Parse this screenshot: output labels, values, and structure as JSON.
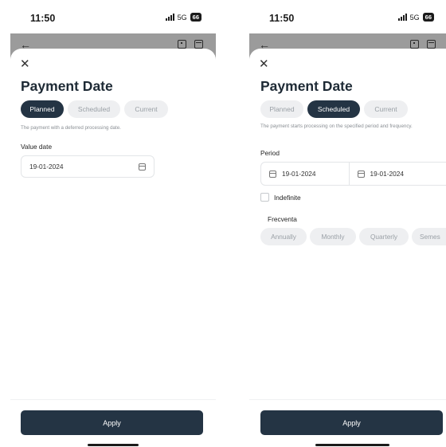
{
  "status": {
    "time": "11:50",
    "network": "5G",
    "battery": "66"
  },
  "screens": [
    {
      "title": "Payment Date",
      "tabs": [
        {
          "label": "Planned",
          "active": true
        },
        {
          "label": "Scheduled",
          "active": false
        },
        {
          "label": "Current",
          "active": false
        }
      ],
      "description": "The payment with a deferred processing date.",
      "value_date_label": "Value date",
      "value_date": "19-01-2024",
      "apply_label": "Apply"
    },
    {
      "title": "Payment Date",
      "tabs": [
        {
          "label": "Planned",
          "active": false
        },
        {
          "label": "Scheduled",
          "active": true
        },
        {
          "label": "Current",
          "active": false
        }
      ],
      "description": "The payment starts processing on the specified period and frequency.",
      "period_label": "Period",
      "period_start": "19-01-2024",
      "period_end": "19-01-2024",
      "indefinite_label": "Indefinite",
      "indefinite_checked": false,
      "frequency_label": "Frecventa",
      "frequency_options": [
        "Annually",
        "Monthly",
        "Quarterly",
        "Semes"
      ],
      "apply_label": "Apply"
    }
  ],
  "colors": {
    "primary": "#243444",
    "chip_bg": "#eeeff1",
    "chip_text": "#9aa0a6",
    "appbar_overlay": "#9b9b9b"
  },
  "icons": {
    "back": "arrow-left",
    "add": "plus-square",
    "calendar": "calendar",
    "close": "x"
  }
}
